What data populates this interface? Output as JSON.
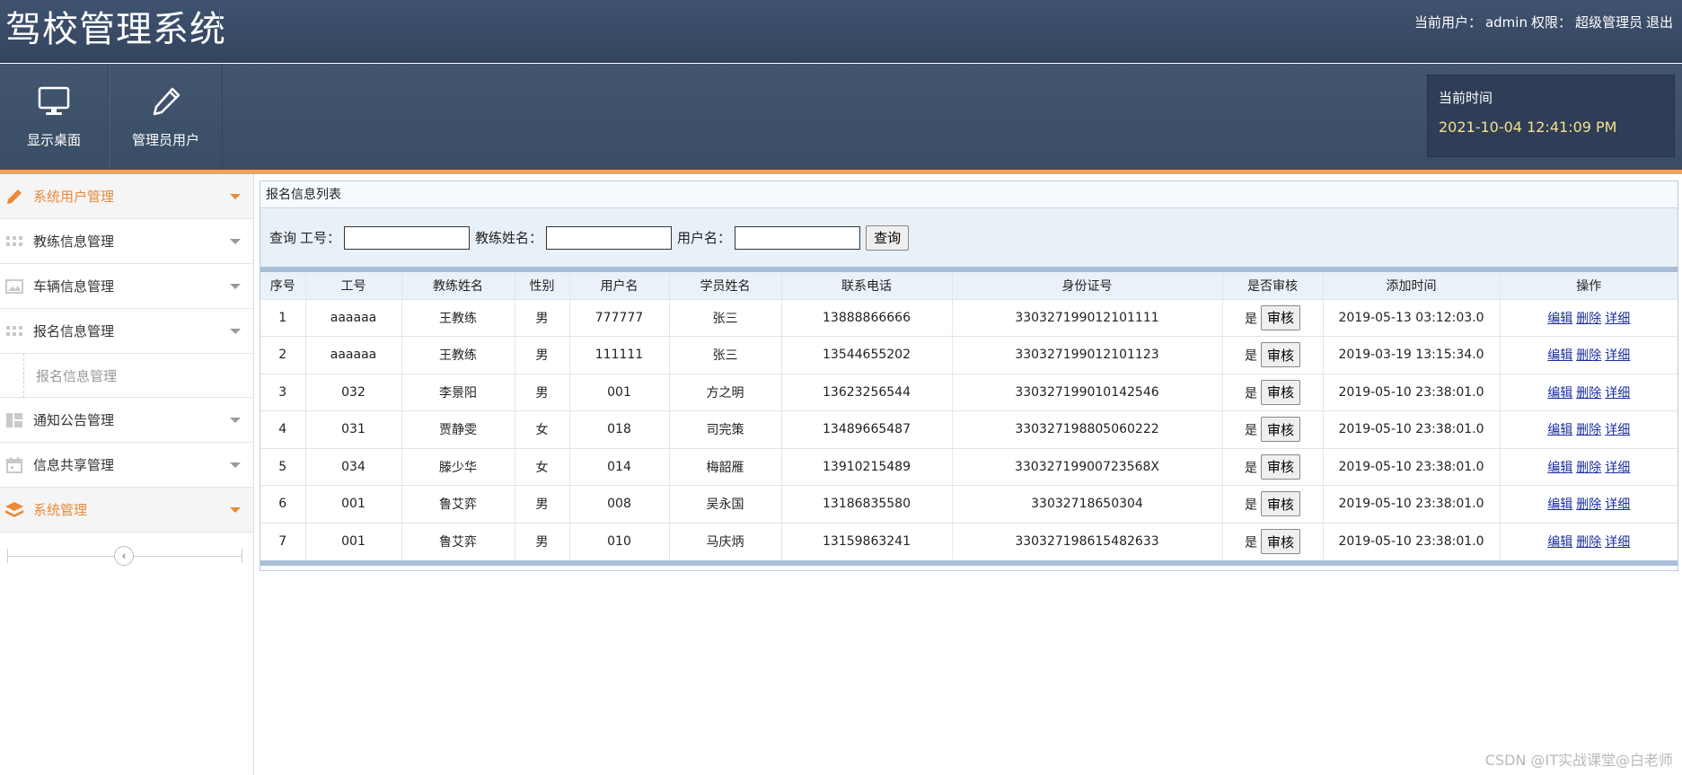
{
  "header": {
    "app_title": "驾校管理系统",
    "current_user_label": "当前用户：",
    "current_user": "admin",
    "role_label": "权限：",
    "role": "超级管理员",
    "logout": "退出"
  },
  "toolbar": {
    "desktop_label": "显示桌面",
    "admin_label": "管理员用户",
    "clock_label": "当前时间",
    "clock_value": "2021-10-04 12:41:09 PM"
  },
  "sidebar": {
    "items": [
      {
        "label": "系统用户管理",
        "icon": "pencil-icon",
        "active": true
      },
      {
        "label": "教练信息管理",
        "icon": "grid-icon"
      },
      {
        "label": "车辆信息管理",
        "icon": "picture-icon"
      },
      {
        "label": "报名信息管理",
        "icon": "grid-icon"
      },
      {
        "label": "通知公告管理",
        "icon": "layout-icon"
      },
      {
        "label": "信息共享管理",
        "icon": "calendar-icon"
      },
      {
        "label": "系统管理",
        "icon": "stack-icon",
        "active": true
      }
    ],
    "sub_item": "报名信息管理",
    "collapse_glyph": "‹"
  },
  "panel": {
    "title": "报名信息列表",
    "search": {
      "query_label": "查询",
      "job_no_label": "工号：",
      "coach_name_label": "教练姓名：",
      "username_label": "用户名：",
      "job_no_value": "",
      "coach_name_value": "",
      "username_value": "",
      "button": "查询"
    },
    "columns": [
      "序号",
      "工号",
      "教练姓名",
      "性别",
      "用户名",
      "学员姓名",
      "联系电话",
      "身份证号",
      "是否审核",
      "添加时间",
      "操作"
    ],
    "rows": [
      [
        "1",
        "aaaaaa",
        "王教练",
        "男",
        "777777",
        "张三",
        "13888866666",
        "330327199012101111",
        "是",
        "2019-05-13 03:12:03.0"
      ],
      [
        "2",
        "aaaaaa",
        "王教练",
        "男",
        "111111",
        "张三",
        "13544655202",
        "330327199012101123",
        "是",
        "2019-03-19 13:15:34.0"
      ],
      [
        "3",
        "032",
        "李景阳",
        "男",
        "001",
        "方之明",
        "13623256544",
        "330327199010142546",
        "是",
        "2019-05-10 23:38:01.0"
      ],
      [
        "4",
        "031",
        "贾静雯",
        "女",
        "018",
        "司完策",
        "13489665487",
        "330327198805060222",
        "是",
        "2019-05-10 23:38:01.0"
      ],
      [
        "5",
        "034",
        "滕少华",
        "女",
        "014",
        "梅韶雁",
        "13910215489",
        "33032719900723568X",
        "是",
        "2019-05-10 23:38:01.0"
      ],
      [
        "6",
        "001",
        "鲁艾弈",
        "男",
        "008",
        "吴永国",
        "13186835580",
        "33032718650304",
        "是",
        "2019-05-10 23:38:01.0"
      ],
      [
        "7",
        "001",
        "鲁艾弈",
        "男",
        "010",
        "马庆炳",
        "13159863241",
        "330327198615482633",
        "是",
        "2019-05-10 23:38:01.0"
      ]
    ],
    "audit_button": "审核",
    "actions": {
      "edit": "编辑",
      "delete": "删除",
      "detail": "详细"
    }
  },
  "watermark": "CSDN @IT实战课堂@白老师",
  "colors": {
    "header_bg": "#3f526f",
    "accent_orange": "#f0a45a",
    "active_menu_text": "#e98a3a",
    "clock_text": "#f5e08c",
    "link": "#1a2fa0"
  }
}
